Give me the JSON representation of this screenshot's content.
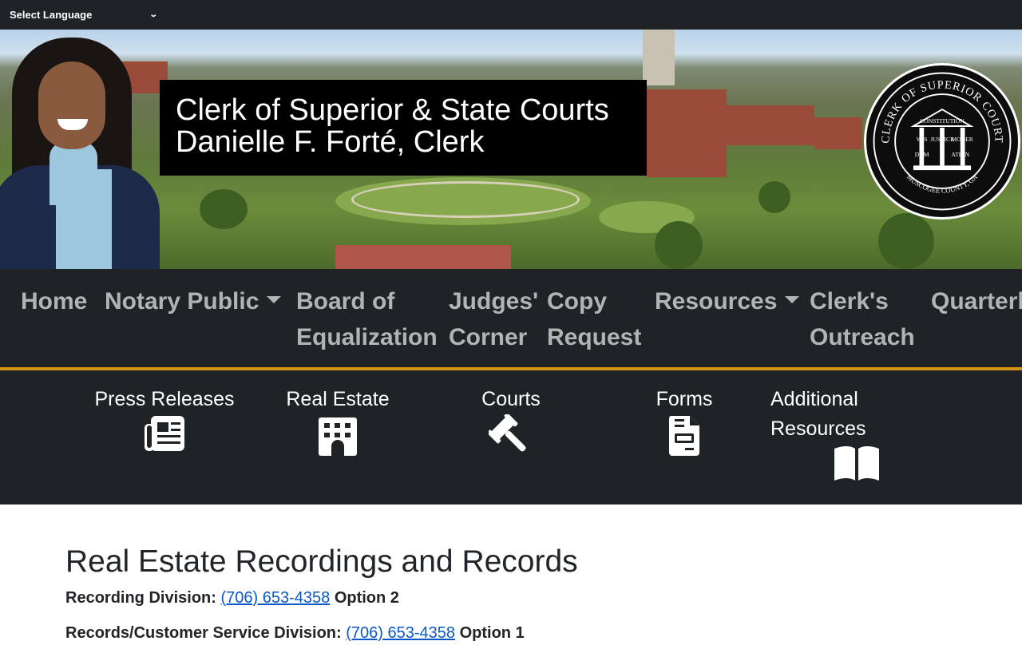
{
  "language_bar": {
    "select_label": "Select Language"
  },
  "header": {
    "title_line1": "Clerk of Superior & State Courts",
    "title_line2": "Danielle F. Forté, Clerk",
    "seal": {
      "outer_text": "CLERK OF SUPERIOR COURT",
      "inner_top": "CONSTITUTION",
      "left_top": "WIS",
      "left_bottom": "DOM",
      "center": "JUSTICE",
      "right_top": "MODER",
      "right_bottom": "ATION",
      "bottom_text": "MUSCOGEE COUNTY, GA"
    }
  },
  "main_nav": {
    "items": [
      {
        "label": "Home",
        "dropdown": false
      },
      {
        "label": "Notary Public",
        "dropdown": true
      },
      {
        "label_line1": "Board of",
        "label_line2": "Equalization",
        "dropdown": false
      },
      {
        "label_line1": "Judges'",
        "label_line2": "Corner",
        "dropdown": false
      },
      {
        "label_line1": "Copy",
        "label_line2": "Request",
        "dropdown": false
      },
      {
        "label": "Resources",
        "dropdown": true
      },
      {
        "label_line1": "Clerk's",
        "label_line2": "Outreach",
        "dropdown": false
      },
      {
        "label": "Quarterl",
        "dropdown": false
      }
    ]
  },
  "sub_nav": {
    "items": [
      {
        "label": "Press Releases",
        "icon": "newspaper-icon"
      },
      {
        "label": "Real Estate",
        "icon": "building-icon"
      },
      {
        "label": "Courts",
        "icon": "gavel-icon"
      },
      {
        "label": "Forms",
        "icon": "file-icon"
      },
      {
        "label_line1": "Additional",
        "label_line2": "Resources",
        "icon": "book-open-icon"
      }
    ]
  },
  "content": {
    "heading": "Real Estate Recordings and Records",
    "lines": [
      {
        "prefix": "Recording Division:",
        "phone": "(706) 653-4358",
        "suffix": "Option 2"
      },
      {
        "prefix": "Records/Customer Service Division:",
        "phone": "(706) 653-4358",
        "suffix": "Option 1"
      }
    ]
  },
  "colors": {
    "nav_bg": "#1f2326",
    "accent_border": "#d4920f",
    "link": "#0a58ca"
  }
}
